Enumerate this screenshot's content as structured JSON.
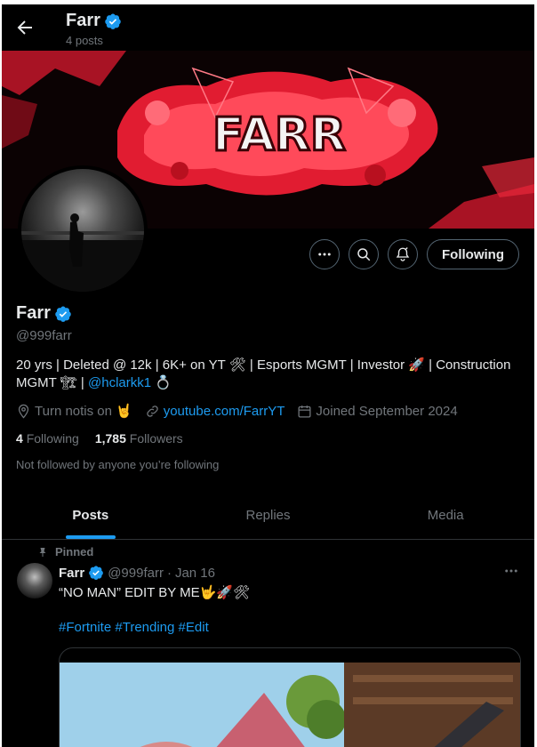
{
  "header": {
    "name": "Farr",
    "posts": "4 posts"
  },
  "profile": {
    "name": "Farr",
    "handle": "@999farr",
    "bio_part1": "20 yrs | Deleted @ 12k | 6K+ on YT ",
    "bio_part2": " | Esports MGMT | Investor ",
    "bio_part3": " | Construction MGMT ",
    "bio_part4": " | ",
    "bio_mention": "@hclarkk1",
    "location": "Turn notis on",
    "website": "youtube.com/FarrYT",
    "joined": "Joined September 2024",
    "following_count": "4",
    "following_label": "Following",
    "followers_count": "1,785",
    "followers_label": "Followers",
    "not_followed": "Not followed by anyone you’re following"
  },
  "banner": {
    "logo_text": "FARR"
  },
  "actions": {
    "following_label": "Following"
  },
  "tabs": [
    {
      "label": "Posts",
      "active": true
    },
    {
      "label": "Replies",
      "active": false
    },
    {
      "label": "Media",
      "active": false
    }
  ],
  "tweet": {
    "pinned_label": "Pinned",
    "name": "Farr",
    "handle": "@999farr",
    "sep": "·",
    "date": "Jan 16",
    "text": "“NO MAN” EDIT BY ME",
    "hashtags": [
      "#Fortnite",
      "#Trending",
      "#Edit"
    ]
  },
  "colors": {
    "accent": "#1d9bf0",
    "background": "#000000",
    "muted": "#71767b",
    "banner_red": "#e8283a"
  },
  "icons": [
    "back-arrow-icon",
    "verified-badge-icon",
    "more-icon",
    "search-icon",
    "notification-bell-icon",
    "location-icon",
    "link-icon",
    "calendar-icon",
    "pin-icon"
  ]
}
